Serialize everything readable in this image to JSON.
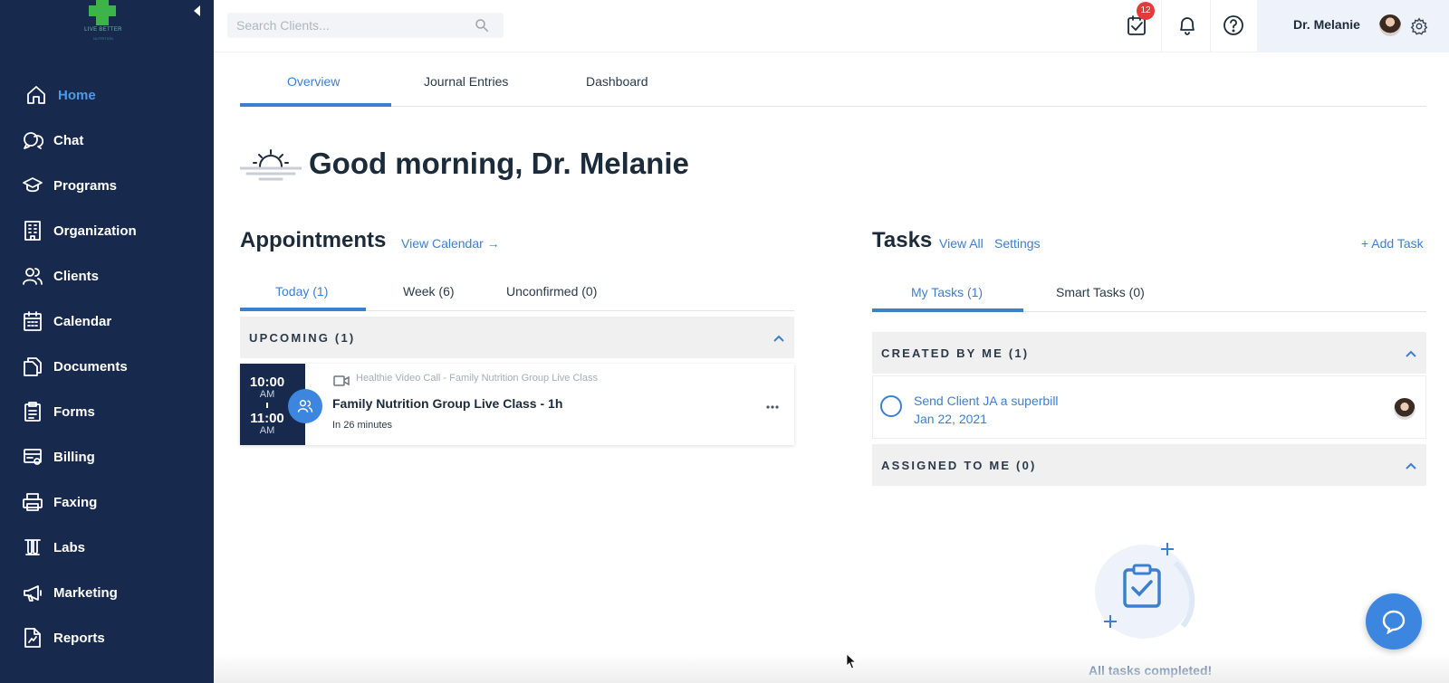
{
  "sidebar": {
    "logo_text": "LIVE BETTER",
    "logo_subtext": "NUTRITION",
    "items": [
      {
        "label": "Home",
        "icon": "home-icon",
        "active": true
      },
      {
        "label": "Chat",
        "icon": "chat-icon"
      },
      {
        "label": "Programs",
        "icon": "graduation-cap-icon"
      },
      {
        "label": "Organization",
        "icon": "building-icon"
      },
      {
        "label": "Clients",
        "icon": "users-icon"
      },
      {
        "label": "Calendar",
        "icon": "calendar-icon"
      },
      {
        "label": "Documents",
        "icon": "documents-icon"
      },
      {
        "label": "Forms",
        "icon": "clipboard-icon"
      },
      {
        "label": "Billing",
        "icon": "billing-icon"
      },
      {
        "label": "Faxing",
        "icon": "printer-icon"
      },
      {
        "label": "Labs",
        "icon": "test-tubes-icon"
      },
      {
        "label": "Marketing",
        "icon": "megaphone-icon"
      },
      {
        "label": "Reports",
        "icon": "report-icon"
      }
    ]
  },
  "topbar": {
    "search_placeholder": "Search Clients...",
    "tasks_badge": "12",
    "user_name": "Dr. Melanie"
  },
  "main_tabs": [
    "Overview",
    "Journal Entries",
    "Dashboard"
  ],
  "greeting": "Good morning, Dr. Melanie",
  "appointments": {
    "title": "Appointments",
    "link": "View Calendar →",
    "tabs": [
      "Today (1)",
      "Week (6)",
      "Unconfirmed (0)"
    ],
    "group_label": "UPCOMING (1)",
    "card": {
      "start_time": "10:00",
      "start_ampm": "AM",
      "end_time": "11:00",
      "end_ampm": "AM",
      "type": "Healthie Video Call - Family Nutrition Group Live Class",
      "title": "Family Nutrition Group Live Class - 1h",
      "when": "In 26 minutes"
    }
  },
  "tasks": {
    "title": "Tasks",
    "view_all": "View All",
    "settings": "Settings",
    "add_task": "+ Add Task",
    "tabs": [
      "My Tasks (1)",
      "Smart Tasks (0)"
    ],
    "created_label": "CREATED BY ME (1)",
    "assigned_label": "ASSIGNED TO ME (0)",
    "task": {
      "title": "Send Client JA a superbill",
      "date": "Jan 22, 2021"
    },
    "empty_text": "All tasks completed!"
  },
  "colors": {
    "sidebar": "#172a4e",
    "accent": "#3d7fcf",
    "badge": "#e33b3b"
  }
}
